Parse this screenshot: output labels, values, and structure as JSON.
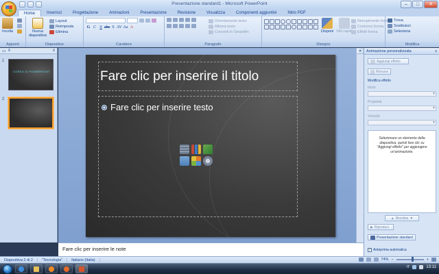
{
  "window": {
    "title": "Presentazione standard1 - Microsoft PowerPoint",
    "minimize": "–",
    "maximize": "□",
    "close": "✕"
  },
  "tabs": [
    "Home",
    "Inserisci",
    "Progettazione",
    "Animazioni",
    "Presentazione",
    "Revisione",
    "Visualizza",
    "Componenti aggiuntivi",
    "Nitro PDF"
  ],
  "ribbon": {
    "appunti": {
      "label": "Appunti",
      "incolla": "Incolla"
    },
    "diapositive": {
      "label": "Diapositive",
      "nuova": "Nuova diapositiva",
      "layout": "Layout",
      "reimposta": "Reimposta",
      "elimina": "Elimina"
    },
    "carattere": {
      "label": "Carattere"
    },
    "paragrafo": {
      "label": "Paragrafo",
      "orientamento": "Orientamento testo",
      "allinea": "Allinea testo",
      "converti": "Converti in SmartArt"
    },
    "disegno": {
      "label": "Disegno",
      "disponi": "Disponi",
      "stili": "Stili rapidi",
      "riempimento": "Riempimento forma",
      "contorno": "Contorno forma",
      "effetti": "Effetti forma"
    },
    "modifica": {
      "label": "Modifica",
      "trova": "Trova",
      "sostituisci": "Sostituisci",
      "seleziona": "Seleziona"
    }
  },
  "panel_tabs": {
    "slides": "▭",
    "outline": "≡",
    "close": "x"
  },
  "slides": [
    {
      "number": "1",
      "title": "CORSO DI POWERPOINT"
    },
    {
      "number": "2",
      "title": ""
    }
  ],
  "slide": {
    "title_placeholder": "Fare clic per inserire il titolo",
    "body_placeholder": "Fare clic per inserire testo"
  },
  "notes": {
    "placeholder": "Fare clic per inserire le note"
  },
  "taskpane": {
    "title": "Animazione personalizzata",
    "close": "x",
    "add_effect": "Aggiungi effetto",
    "remove": "Rimuovi",
    "modify_effect": "Modifica effetto",
    "start_label": "Inizio",
    "property_label": "Proprietà",
    "speed_label": "Velocità",
    "hint": "Selezionare un elemento della diapositiva, quindi fare clic su \"Aggiungi effetto\" per aggiungere un'animazione.",
    "reorder": "Riordina",
    "play": "Riproduci",
    "slideshow": "Presentazione standard",
    "autopreview": "Anteprima automatica"
  },
  "status": {
    "slide_count": "Diapositiva 2 di 2",
    "theme": "\"Tecnologia\"",
    "language": "Italiano (Italia)",
    "zoom": "74%"
  },
  "taskbar": {
    "lang": "IT",
    "time": "13:11"
  }
}
